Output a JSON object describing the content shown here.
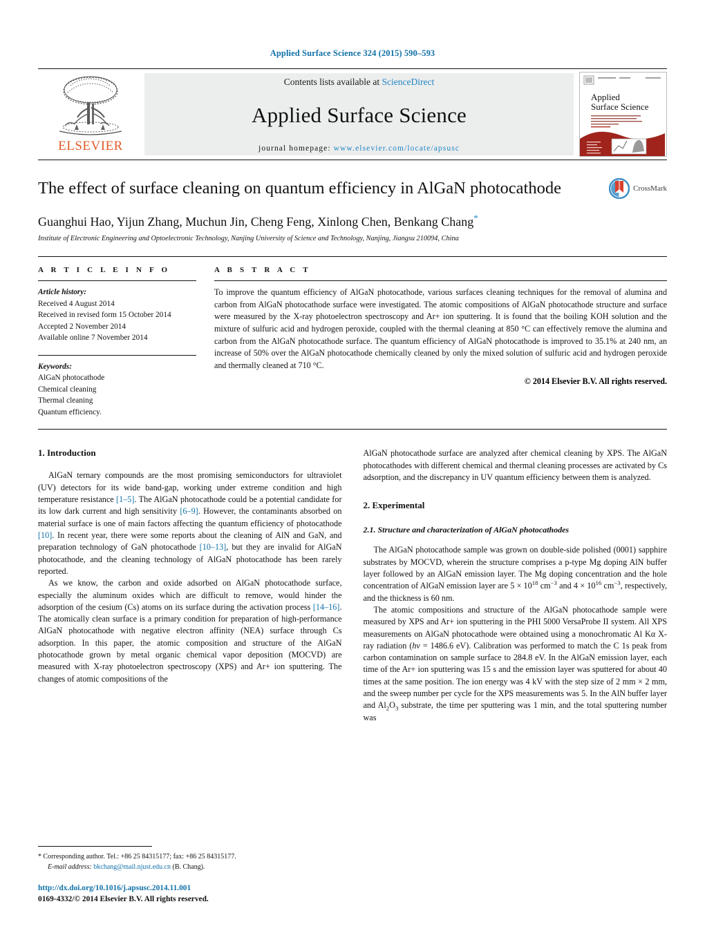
{
  "running_head": "Applied Surface Science 324 (2015) 590–593",
  "masthead": {
    "publisher": "ELSEVIER",
    "contents_prefix": "Contents lists available at ",
    "contents_link": "ScienceDirect",
    "journal_name": "Applied Surface Science",
    "homepage_prefix": "journal homepage:",
    "homepage_url": "www.elsevier.com/locate/apsusc",
    "cover_title_line1": "Applied",
    "cover_title_line2": "Surface Science",
    "link_color": "#1f86c4"
  },
  "article": {
    "title": "The effect of surface cleaning on quantum efficiency in AlGaN photocathode",
    "authors": "Guanghui Hao, Yijun Zhang, Muchun Jin, Cheng Feng, Xinlong Chen, Benkang Chang",
    "affiliation": "Institute of Electronic Engineering and Optoelectronic Technology, Nanjing University of Science and Technology, Nanjing, Jiangsu 210094, China",
    "crossmark_label": "CrossMark"
  },
  "info": {
    "heading": "A R T I C L E    I N F O",
    "history_label": "Article history:",
    "history": [
      "Received 4 August 2014",
      "Received in revised form 15 October 2014",
      "Accepted 2 November 2014",
      "Available online 7 November 2014"
    ],
    "keywords_label": "Keywords:",
    "keywords": [
      "AlGaN photocathode",
      "Chemical cleaning",
      "Thermal cleaning",
      "Quantum efficiency."
    ]
  },
  "abstract": {
    "heading": "A B S T R A C T",
    "text": "To improve the quantum efficiency of AlGaN photocathode, various surfaces cleaning techniques for the removal of alumina and carbon from AlGaN photocathode surface were investigated. The atomic compositions of AlGaN photocathode structure and surface were measured by the X-ray photoelectron spectroscopy and Ar+ ion sputtering. It is found that the boiling KOH solution and the mixture of sulfuric acid and hydrogen peroxide, coupled with the thermal cleaning at 850 °C can effectively remove the alumina and carbon from the AlGaN photocathode surface. The quantum efficiency of AlGaN photocathode is improved to 35.1% at 240 nm, an increase of 50% over the AlGaN photocathode chemically cleaned by only the mixed solution of sulfuric acid and hydrogen peroxide and thermally cleaned at 710 °C.",
    "copyright": "© 2014 Elsevier B.V. All rights reserved."
  },
  "sections": {
    "intro_heading": "1.  Introduction",
    "intro_p1_a": "AlGaN ternary compounds are the most promising semiconductors for ultraviolet (UV) detectors for its wide band-gap, working under extreme condition and high temperature resistance ",
    "intro_p1_cite1": "[1–5]",
    "intro_p1_b": ". The AlGaN photocathode could be a potential candidate for its low dark current and high sensitivity ",
    "intro_p1_cite2": "[6–9]",
    "intro_p1_c": ". However, the contaminants absorbed on material surface is one of main factors affecting the quantum efficiency of photocathode ",
    "intro_p1_cite3": "[10]",
    "intro_p1_d": ". In recent year, there were some reports about the cleaning of AlN and GaN, and preparation technology of GaN photocathode ",
    "intro_p1_cite4": "[10–13]",
    "intro_p1_e": ", but they are invalid for AlGaN photocathode, and the cleaning technology of AlGaN photocathode has been rarely reported.",
    "intro_p2_a": "As we know, the carbon and oxide adsorbed on AlGaN photocathode surface, especially the aluminum oxides which are difficult to remove, would hinder the adsorption of the cesium (Cs) atoms on its surface during the activation process ",
    "intro_p2_cite1": "[14–16]",
    "intro_p2_b": ". The atomically clean surface is a primary condition for preparation of high-performance AlGaN photocathode with negative electron affinity (NEA) surface through Cs adsorption. In this paper, the atomic composition and structure of the AlGaN photocathode grown by metal organic chemical vapor deposition (MOCVD) are measured with X-ray photoelectron spectroscopy (XPS) and Ar+ ion sputtering. The changes of atomic compositions of the",
    "right_p1": "AlGaN photocathode surface are analyzed after chemical cleaning by XPS. The AlGaN photocathodes with different chemical and thermal cleaning processes are activated by Cs adsorption, and the discrepancy in UV quantum efficiency between them is analyzed.",
    "exp_heading": "2.  Experimental",
    "exp_sub_heading": "2.1.  Structure and characterization of AlGaN photocathodes",
    "exp_p1_a": "The AlGaN photocathode sample was grown on double-side polished (0001) sapphire substrates by MOCVD, wherein the structure comprises a p-type Mg doping AlN buffer layer followed by an AlGaN emission layer. The Mg doping concentration and the hole concentration of AlGaN emission layer are 5 × 10",
    "exp_p1_sup1": "18",
    "exp_p1_b": " cm",
    "exp_p1_sup2": "−3",
    "exp_p1_c": " and 4 × 10",
    "exp_p1_sup3": "16",
    "exp_p1_d": " cm",
    "exp_p1_sup4": "−3",
    "exp_p1_e": ", respectively, and the thickness is 60 nm.",
    "exp_p2_a": "The atomic compositions and structure of the AlGaN photocathode sample were measured by XPS and Ar+ ion sputtering in the PHI 5000 VersaProbe II system. All XPS measurements on AlGaN photocathode were obtained using a monochromatic Al Kα X-ray radiation (",
    "exp_p2_italic": "hν",
    "exp_p2_b": " = 1486.6 eV). Calibration was performed to match the C 1s peak from carbon contamination on sample surface to 284.8 eV. In the AlGaN emission layer, each time of the Ar+ ion sputtering was 15 s and the emission layer was sputtered for about 40 times at the same position. The ion energy was 4 kV with the step size of 2 mm × 2 mm, and the sweep number per cycle for the XPS measurements was 5. In the AlN buffer layer and Al",
    "exp_p2_sub1": "2",
    "exp_p2_c": "O",
    "exp_p2_sub2": "3",
    "exp_p2_d": " substrate, the time per sputtering was 1 min, and the total sputtering number was"
  },
  "footnote": {
    "corresponding": "*  Corresponding author. Tel.: +86 25 84315177; fax: +86 25 84315177.",
    "email_label": "E-mail address:",
    "email": "bkchang@mail.njust.edu.cn",
    "email_suffix": " (B. Chang)."
  },
  "doi_block": {
    "doi": "http://dx.doi.org/10.1016/j.apsusc.2014.11.001",
    "issn_line": "0169-4332/© 2014 Elsevier B.V. All rights reserved."
  }
}
